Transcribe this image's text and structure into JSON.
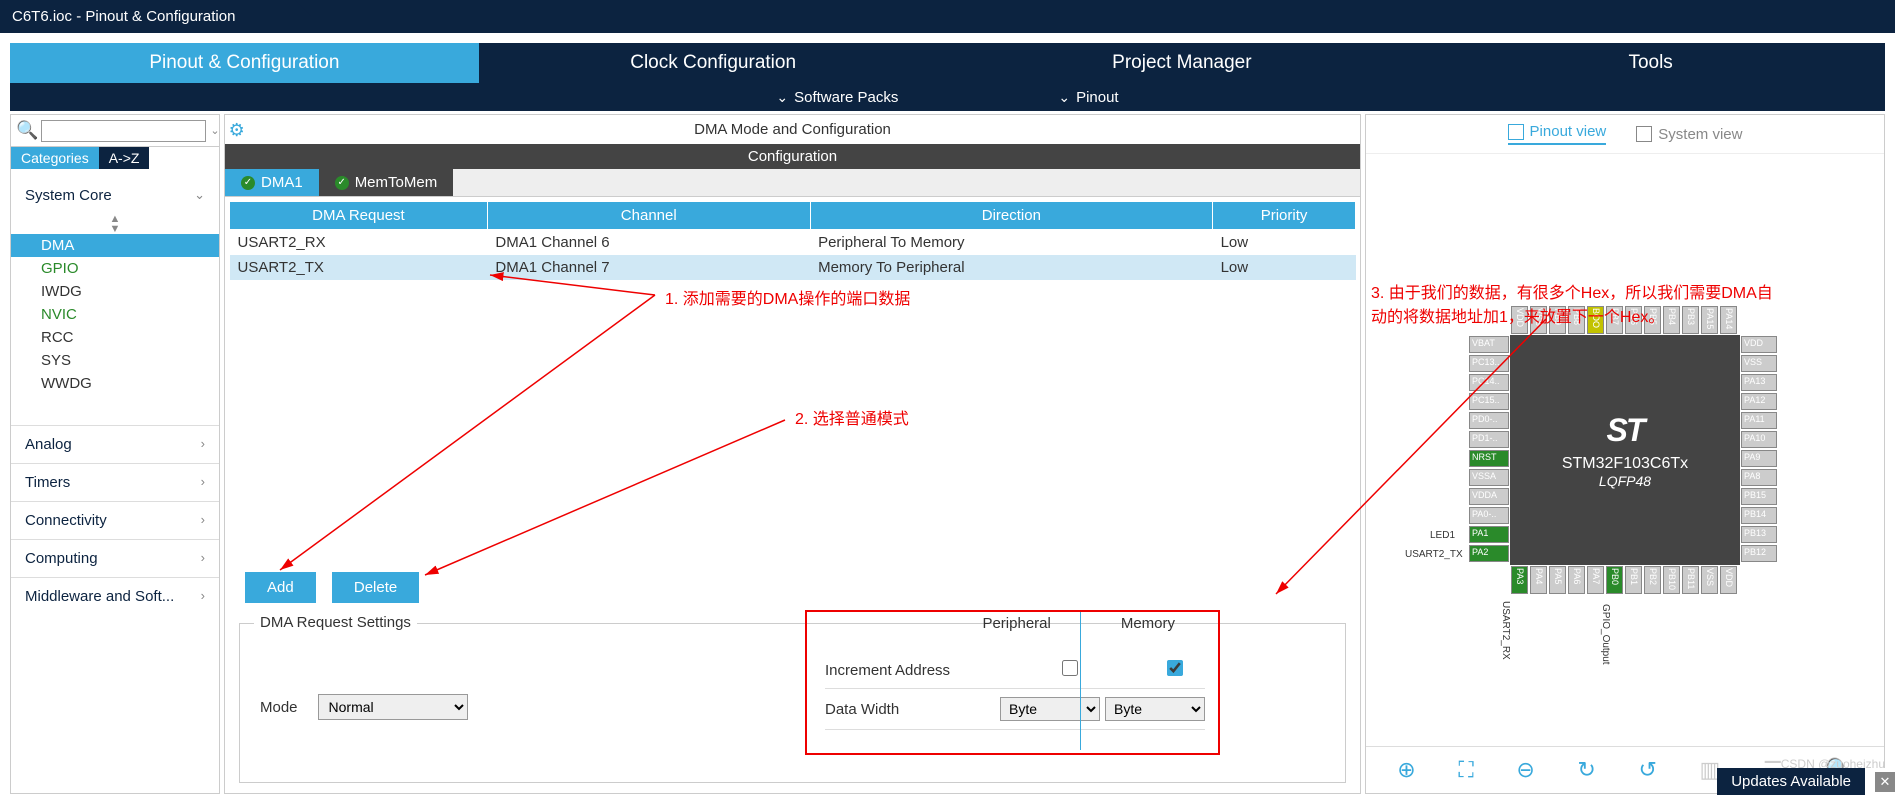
{
  "titlebar": {
    "text": "C6T6.ioc - Pinout & Configuration"
  },
  "tabs": {
    "pinout": "Pinout & Configuration",
    "clock": "Clock Configuration",
    "project": "Project Manager",
    "tools": "Tools"
  },
  "subrow": {
    "software": "Software Packs",
    "pinout": "Pinout"
  },
  "search": {
    "placeholder": ""
  },
  "cat_tabs": {
    "categories": "Categories",
    "az": "A->Z"
  },
  "sidebar": {
    "system_core": "System Core",
    "items": [
      "DMA",
      "GPIO",
      "IWDG",
      "NVIC",
      "RCC",
      "SYS",
      "WWDG"
    ],
    "groups": [
      "Analog",
      "Timers",
      "Connectivity",
      "Computing",
      "Middleware and Soft..."
    ]
  },
  "center": {
    "title": "DMA Mode and Configuration",
    "config_hdr": "Configuration",
    "subtabs": {
      "dma1": "DMA1",
      "mem": "MemToMem"
    },
    "headers": [
      "DMA Request",
      "Channel",
      "Direction",
      "Priority"
    ],
    "rows": [
      {
        "req": "USART2_RX",
        "ch": "DMA1 Channel 6",
        "dir": "Peripheral To Memory",
        "pri": "Low"
      },
      {
        "req": "USART2_TX",
        "ch": "DMA1 Channel 7",
        "dir": "Memory To Peripheral",
        "pri": "Low"
      }
    ],
    "add": "Add",
    "delete": "Delete",
    "settings_legend": "DMA Request Settings",
    "mode_label": "Mode",
    "mode_value": "Normal",
    "col_periph": "Peripheral",
    "col_mem": "Memory",
    "inc_addr": "Increment Address",
    "data_width": "Data Width",
    "byte": "Byte"
  },
  "right": {
    "pinout_view": "Pinout view",
    "system_view": "System view",
    "chip_name": "STM32F103C6Tx",
    "chip_pkg": "LQFP48",
    "pins_left": [
      "VBAT",
      "PC13..",
      "PC14..",
      "PC15..",
      "PD0-..",
      "PD1-..",
      "NRST",
      "VSSA",
      "VDDA",
      "PA0-..",
      "PA1",
      "PA2"
    ],
    "pins_right": [
      "VDD",
      "VSS",
      "PA13",
      "PA12",
      "PA11",
      "PA10",
      "PA9",
      "PA8",
      "PB15",
      "PB14",
      "PB13",
      "PB12"
    ],
    "pins_top": [
      "VDD",
      "VSS",
      "PB9",
      "PB8",
      "BOO",
      "PB7",
      "PB6",
      "PB5",
      "PB4",
      "PB3",
      "PA15",
      "PA14"
    ],
    "pins_bottom": [
      "PA3",
      "PA4",
      "PA5",
      "PA6",
      "PA7",
      "PB0",
      "PB1",
      "PB2",
      "PB10",
      "PB11",
      "VSS",
      "VDD"
    ],
    "label_led1": "LED1",
    "label_usart2_tx": "USART2_TX",
    "label_usart2_rx": "USART2_RX",
    "label_gpio": "GPIO_Output"
  },
  "footer": {
    "updates": "Updates Available",
    "csdn": "CSDN @zuoheizhu"
  },
  "annotations": {
    "a1": "1. 添加需要的DMA操作的端口数据",
    "a2": "2. 选择普通模式",
    "a3a": "3. 由于我们的数据，有很多个Hex，所以我们需要DMA自",
    "a3b": "动的将数据地址加1，来放置下一个Hex。"
  }
}
